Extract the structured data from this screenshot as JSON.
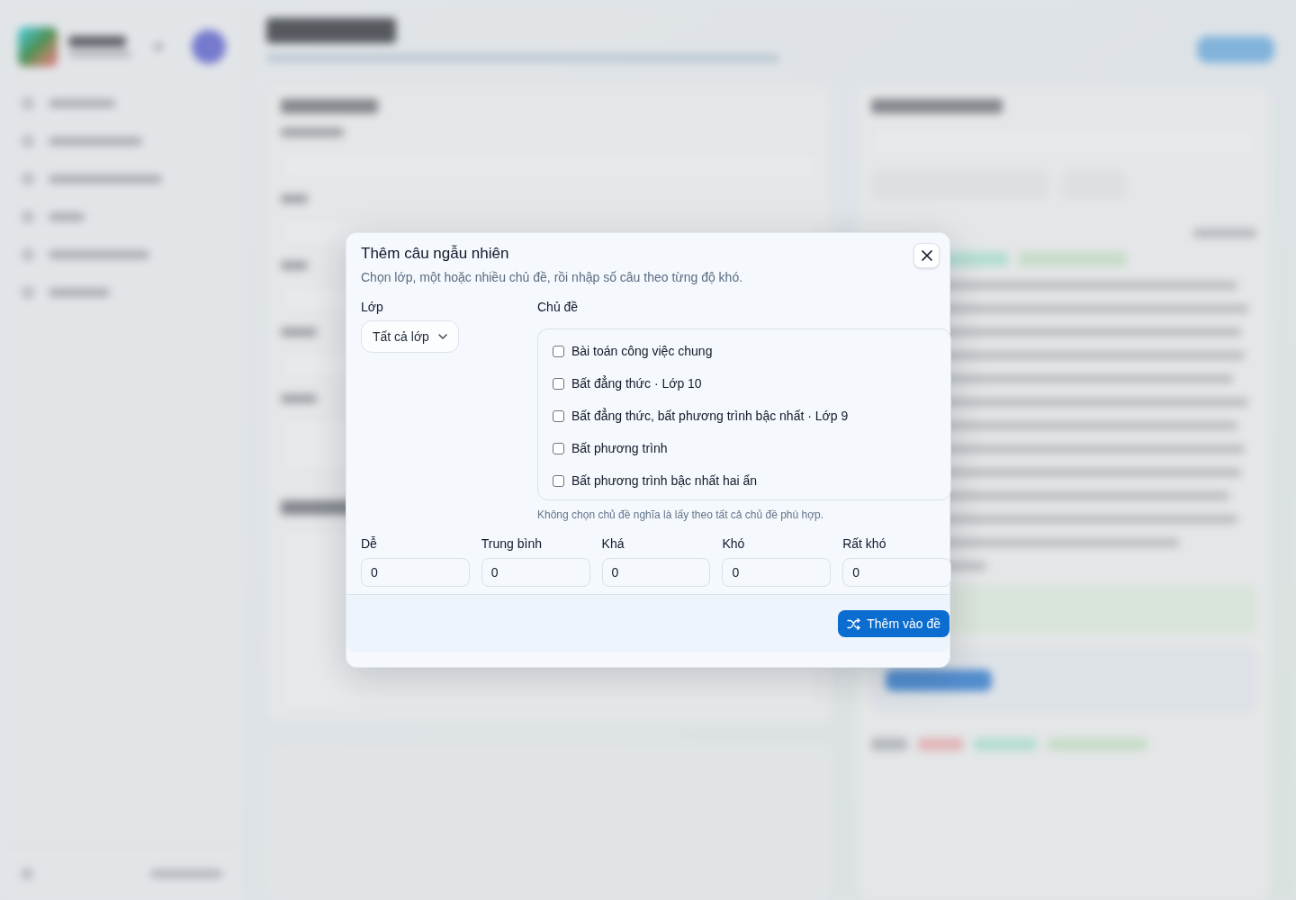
{
  "dialog": {
    "title": "Thêm câu ngẫu nhiên",
    "subtitle": "Chọn lớp, một hoặc nhiều chủ đề, rồi nhập số câu theo từng độ khó."
  },
  "class_field": {
    "label": "Lớp",
    "value": "Tất cả lớp"
  },
  "topics": {
    "label": "Chủ đề",
    "items": [
      {
        "label": "Bài toán công việc chung",
        "checked": false
      },
      {
        "label": "Bất đẳng thức · Lớp 10",
        "checked": false
      },
      {
        "label": "Bất đẳng thức, bất phương trình bậc nhất · Lớp 9",
        "checked": false
      },
      {
        "label": "Bất phương trình",
        "checked": false
      },
      {
        "label": "Bất phương trình bậc nhất hai ẩn",
        "checked": false
      }
    ],
    "hint": "Không chọn chủ đề nghĩa là lấy theo tất cả chủ đề phù hợp."
  },
  "difficulties": [
    {
      "label": "Dễ",
      "value": "0"
    },
    {
      "label": "Trung bình",
      "value": "0"
    },
    {
      "label": "Khá",
      "value": "0"
    },
    {
      "label": "Khó",
      "value": "0"
    },
    {
      "label": "Rất khó",
      "value": "0"
    }
  ],
  "footer": {
    "button": "Thêm vào đề"
  }
}
